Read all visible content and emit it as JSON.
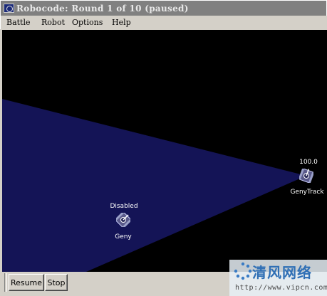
{
  "window": {
    "title": "Robocode: Round 1 of 10 (paused)"
  },
  "menu": {
    "items": [
      "Battle",
      "Robot",
      "Options",
      "Help"
    ]
  },
  "battle": {
    "robots": [
      {
        "name": "GenyTrack",
        "status": "100.0"
      },
      {
        "name": "Geny",
        "status": "Disabled"
      }
    ],
    "colors": {
      "background": "#000000",
      "radar_beam": "#141456"
    }
  },
  "controls": {
    "resume_label": "Resume",
    "stop_label": "Stop"
  },
  "watermark": {
    "brand": "清风网络",
    "url": "http://www.vipcn.com"
  }
}
